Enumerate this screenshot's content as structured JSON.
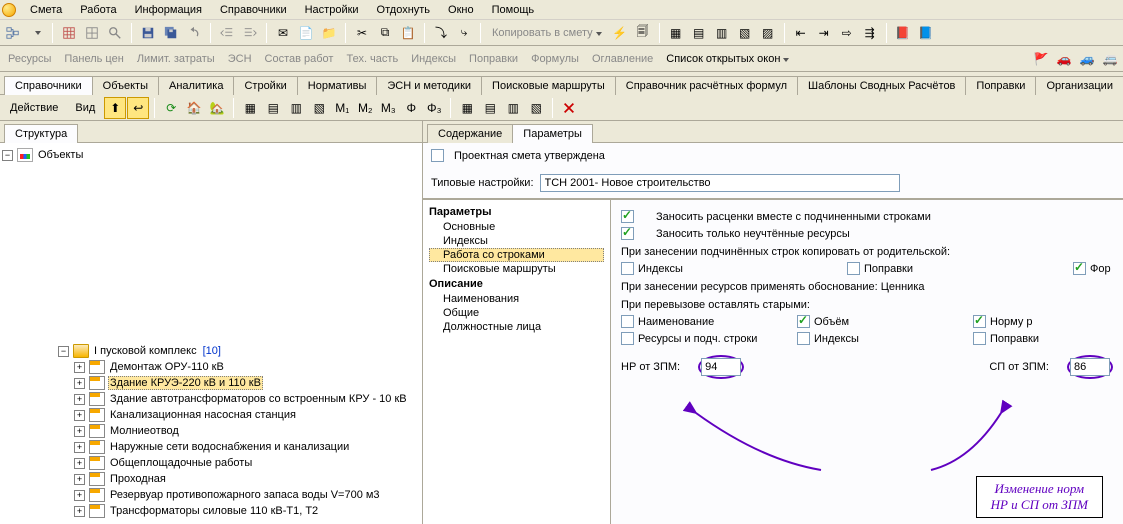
{
  "colors": {
    "accent": "#316ac5",
    "highlight": "#ffe8a0",
    "annot": "#6000c0"
  },
  "menu": {
    "items": [
      "Смета",
      "Работа",
      "Информация",
      "Справочники",
      "Настройки",
      "Отдохнуть",
      "Окно",
      "Помощь"
    ]
  },
  "toolbar2": {
    "gray_items": [
      "Ресурсы",
      "Панель цен",
      "Лимит. затраты",
      "ЭСН",
      "Состав работ",
      "Тех. часть",
      "Индексы",
      "Поправки",
      "Формулы",
      "Оглавление"
    ],
    "active_item": "Список открытых окон",
    "copy_label": "Копировать в смету"
  },
  "tab_strip": {
    "items": [
      "Справочники",
      "Объекты",
      "Аналитика",
      "Стройки",
      "Нормативы",
      "ЭСН и методики",
      "Поисковые маршруты",
      "Справочник расчётных формул",
      "Шаблоны Сводных Расчётов",
      "Поправки",
      "Организации"
    ],
    "active_index": 0
  },
  "left": {
    "structure_tab": "Структура",
    "action_label": "Действие",
    "view_label": "Вид",
    "root_label": "Объекты",
    "group_label": "I пусковой комплекс",
    "group_count": "[10]",
    "nodes": [
      "Демонтаж ОРУ-110 кВ",
      "Здание КРУЭ-220 кВ и 110 кВ",
      "Здание автотрансформаторов со встроенным КРУ - 10 кВ",
      "Канализационная насосная станция",
      "Молниеотвод",
      "Наружные сети водоснабжения и канализации",
      "Общеплощадочные работы",
      "Проходная",
      "Резервуар противопожарного запаса воды V=700 м3",
      "Трансформаторы силовые 110 кВ-Т1, Т2"
    ],
    "selected_index": 1
  },
  "right": {
    "tabs": [
      "Содержание",
      "Параметры"
    ],
    "active_tab": 1,
    "approved_label": "Проектная смета утверждена",
    "typical_label": "Типовые настройки:",
    "typical_value": "ТСН 2001- Новое строительство",
    "param_tree": {
      "title1": "Параметры",
      "items1": [
        "Основные",
        "Индексы",
        "Работа со строками",
        "Поисковые маршруты"
      ],
      "sel_index1": 2,
      "title2": "Описание",
      "items2": [
        "Наименования",
        "Общие",
        "Должностные лица"
      ]
    },
    "form": {
      "chk1": "Заносить расценки вместе с подчиненными строками",
      "chk2": "Заносить только неучтённые ресурсы",
      "sect_copy": "При занесении подчинённых строк копировать от родительской:",
      "copy_items": [
        "Индексы",
        "Поправки",
        "Фор"
      ],
      "sect_res": "При занесении ресурсов применять обоснование:",
      "res_val": "Ценника",
      "sect_recall": "При перевызове оставлять старыми:",
      "recall_row1": [
        {
          "l": "Наименование",
          "c": false
        },
        {
          "l": "Объём",
          "c": true
        },
        {
          "l": "Норму р",
          "c": true
        }
      ],
      "recall_row2": [
        {
          "l": "Ресурсы и подч. строки",
          "c": false
        },
        {
          "l": "Индексы",
          "c": false
        },
        {
          "l": "Поправки",
          "c": false
        }
      ],
      "nr_label": "НР от ЗПМ:",
      "nr_value": "94",
      "sp_label": "СП от ЗПМ:",
      "sp_value": "86"
    },
    "annotation": {
      "line1": "Изменение норм",
      "line2": "НР и СП от ЗПМ"
    }
  }
}
